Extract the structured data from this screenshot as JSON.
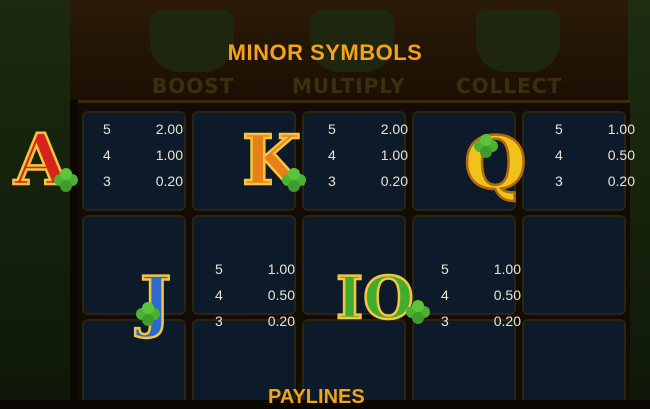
{
  "screen": {
    "title": "MINOR SYMBOLS",
    "footer_title": "PAYLINES"
  },
  "background_labels": {
    "boost": "BOOST",
    "multiply": "MULTIPLY",
    "collect": "COLLECT"
  },
  "symbols": [
    {
      "letter": "A",
      "color": "#d8231b",
      "pays": [
        {
          "count": "5",
          "value": "2.00"
        },
        {
          "count": "4",
          "value": "1.00"
        },
        {
          "count": "3",
          "value": "0.20"
        }
      ]
    },
    {
      "letter": "K",
      "color": "#e8801a",
      "pays": [
        {
          "count": "5",
          "value": "2.00"
        },
        {
          "count": "4",
          "value": "1.00"
        },
        {
          "count": "3",
          "value": "0.20"
        }
      ]
    },
    {
      "letter": "Q",
      "color": "#f1c11c",
      "pays": [
        {
          "count": "5",
          "value": "1.00"
        },
        {
          "count": "4",
          "value": "0.50"
        },
        {
          "count": "3",
          "value": "0.20"
        }
      ]
    },
    {
      "letter": "J",
      "color": "#2c6ad0",
      "pays": [
        {
          "count": "5",
          "value": "1.00"
        },
        {
          "count": "4",
          "value": "0.50"
        },
        {
          "count": "3",
          "value": "0.20"
        }
      ]
    },
    {
      "letter": "IO",
      "color": "#3fae2f",
      "pays": [
        {
          "count": "5",
          "value": "1.00"
        },
        {
          "count": "4",
          "value": "0.50"
        },
        {
          "count": "3",
          "value": "0.20"
        }
      ]
    }
  ]
}
